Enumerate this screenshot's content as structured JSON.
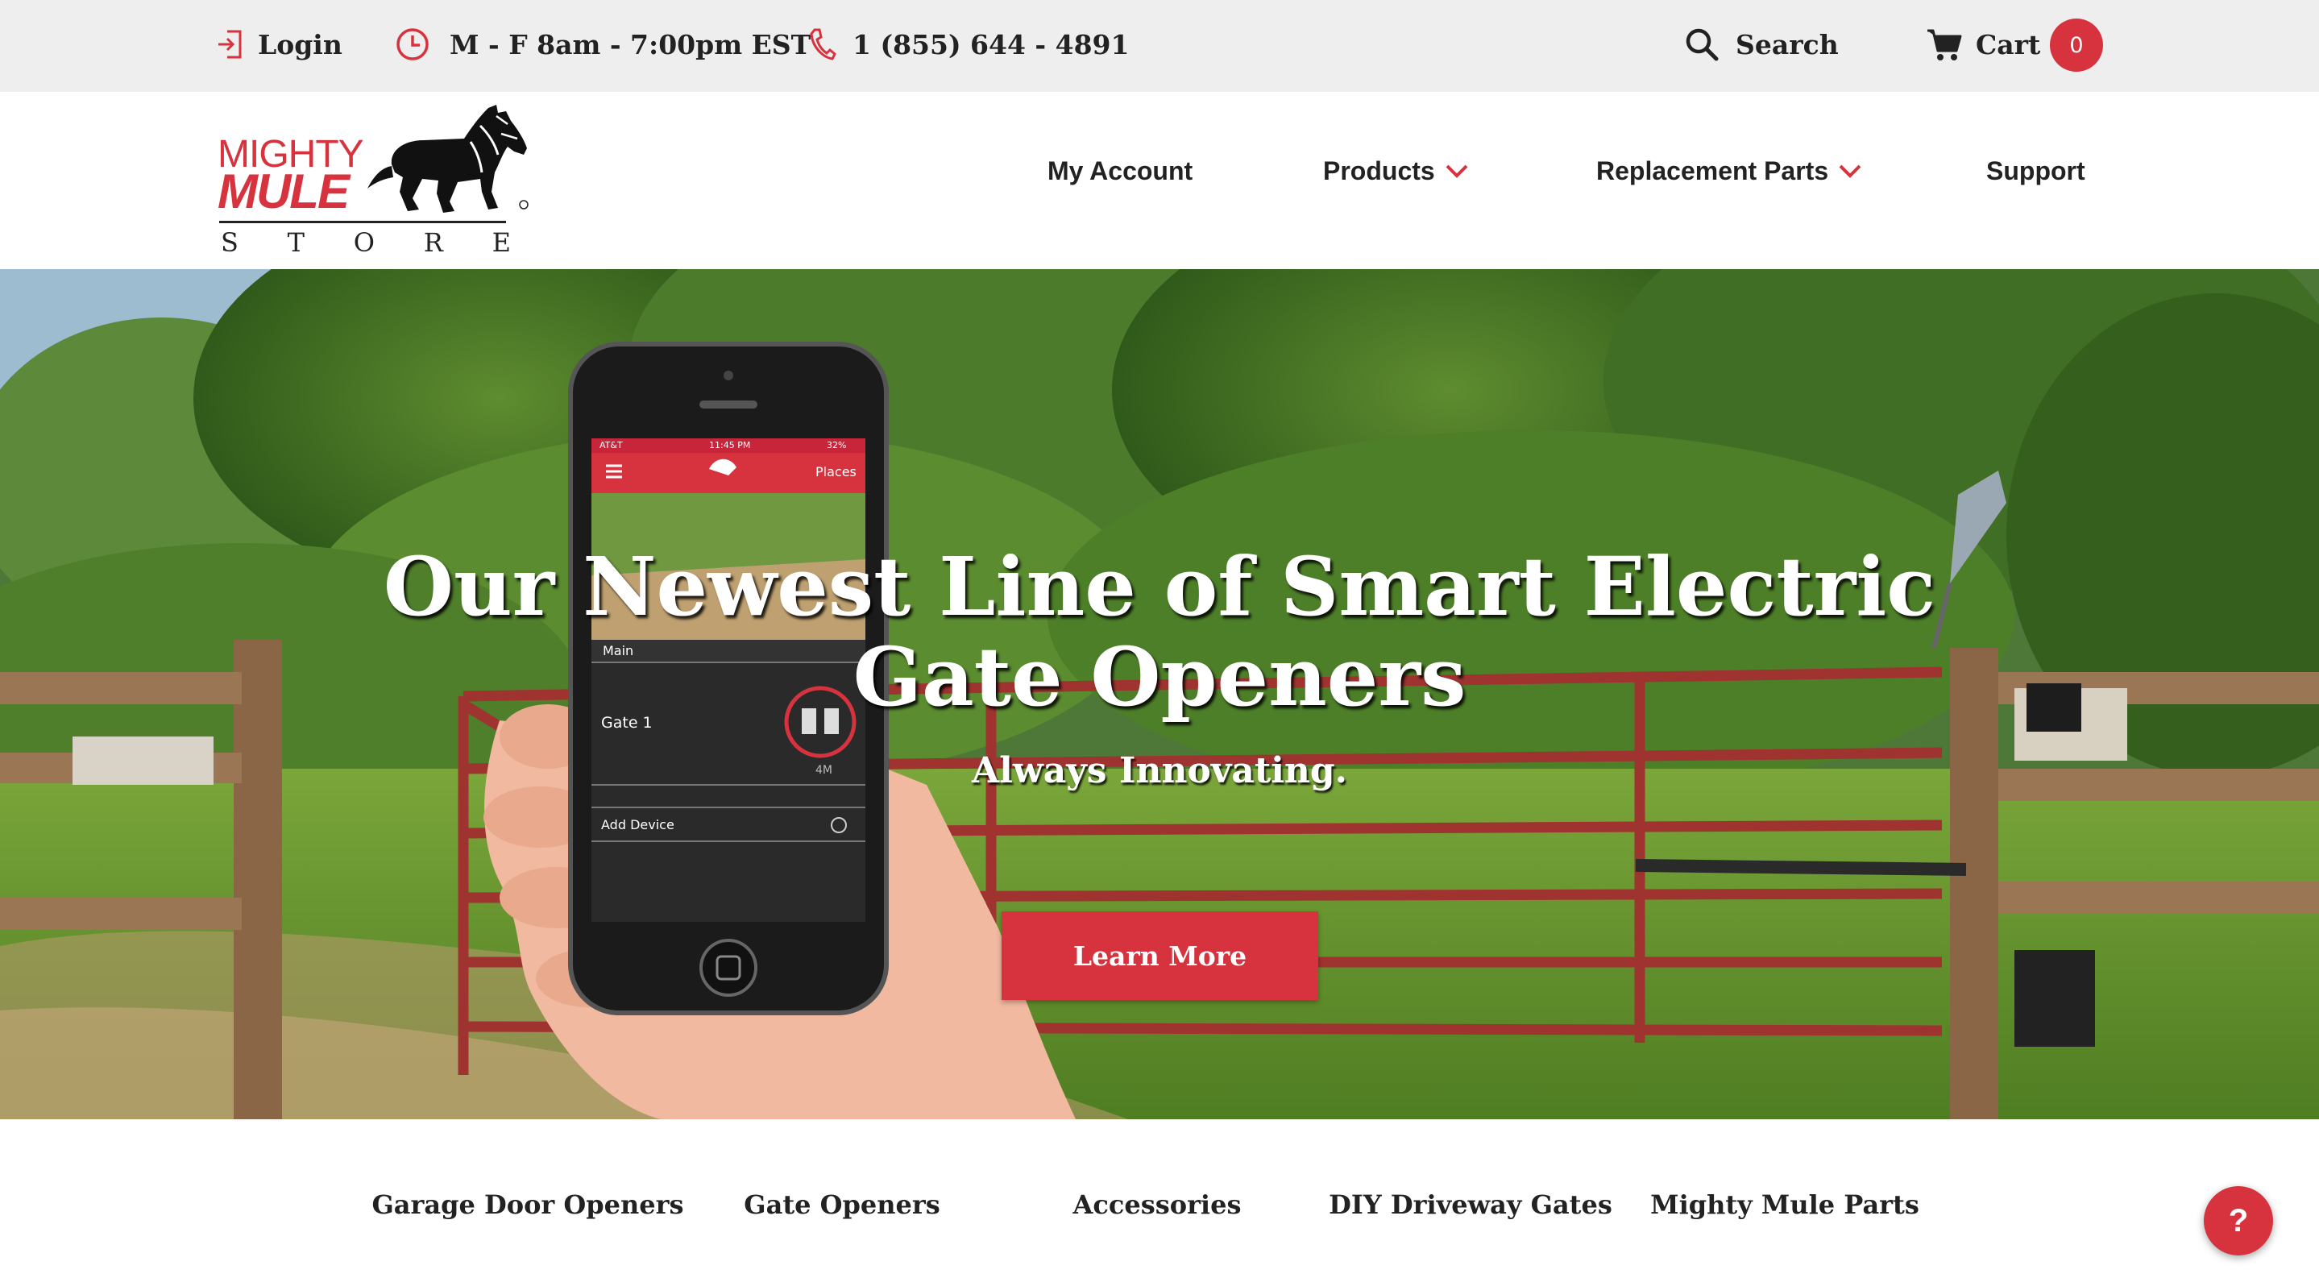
{
  "colors": {
    "accent": "#d7333f",
    "topbar_bg": "#eeeeee",
    "text": "#222222"
  },
  "topbar": {
    "login_label": "Login",
    "login_icon": "login-icon",
    "hours_label": "M - F 8am - 7:00pm EST",
    "hours_icon": "clock-icon",
    "phone_label": "1 (855) 644 - 4891",
    "phone_icon": "phone-icon",
    "search_label": "Search",
    "search_icon": "search-icon",
    "cart_label": "Cart",
    "cart_icon": "cart-icon",
    "cart_count": "0"
  },
  "logo": {
    "line1": "MIGHTY",
    "line2": "MULE",
    "store_letters": [
      "S",
      "T",
      "O",
      "R",
      "E"
    ]
  },
  "nav": {
    "my_account": "My Account",
    "products": "Products",
    "replacement_parts": "Replacement Parts",
    "support": "Support"
  },
  "hero": {
    "title": "Our Newest Line of Smart Electric Gate Openers",
    "subtitle": "Always Innovating.",
    "cta": "Learn More",
    "phone_app": {
      "status_carrier": "AT&T",
      "status_time": "11:45 PM",
      "status_battery": "32%",
      "places_label": "Places",
      "main_label": "Main",
      "gate_label": "Gate 1",
      "gate_model": "4M",
      "add_device_label": "Add Device"
    }
  },
  "categories": [
    "Garage Door Openers",
    "Gate Openers",
    "Accessories",
    "DIY Driveway Gates",
    "Mighty Mule Parts"
  ],
  "help_button": "?"
}
